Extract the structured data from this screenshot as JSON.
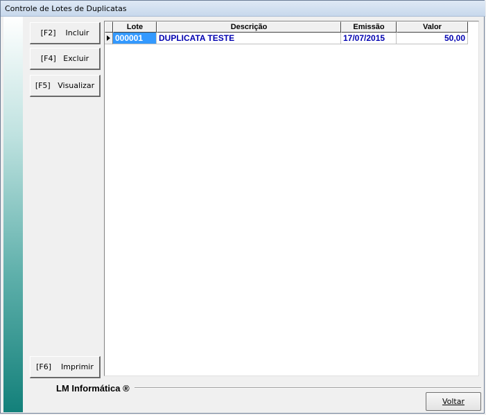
{
  "window": {
    "title": "Controle de Lotes de Duplicatas"
  },
  "sidebar_buttons": [
    {
      "key": "[F2]",
      "label": "Incluir"
    },
    {
      "key": "[F4]",
      "label": "Excluir"
    },
    {
      "key": "[F5]",
      "label": "Visualizar"
    }
  ],
  "print_button": {
    "key": "[F6]",
    "label": "Imprimir"
  },
  "grid": {
    "columns": [
      "Lote",
      "Descrição",
      "Emissão",
      "Valor"
    ],
    "rows": [
      {
        "lote": "000001",
        "descricao": "DUPLICATA TESTE",
        "emissao": "17/07/2015",
        "valor": "50,00"
      }
    ]
  },
  "footer": {
    "company": "LM Informática ®",
    "back_button": "Voltar"
  },
  "colors": {
    "row_text": "#0000b0",
    "selection": "#3399ff",
    "side_strip_bottom": "#13807a"
  }
}
